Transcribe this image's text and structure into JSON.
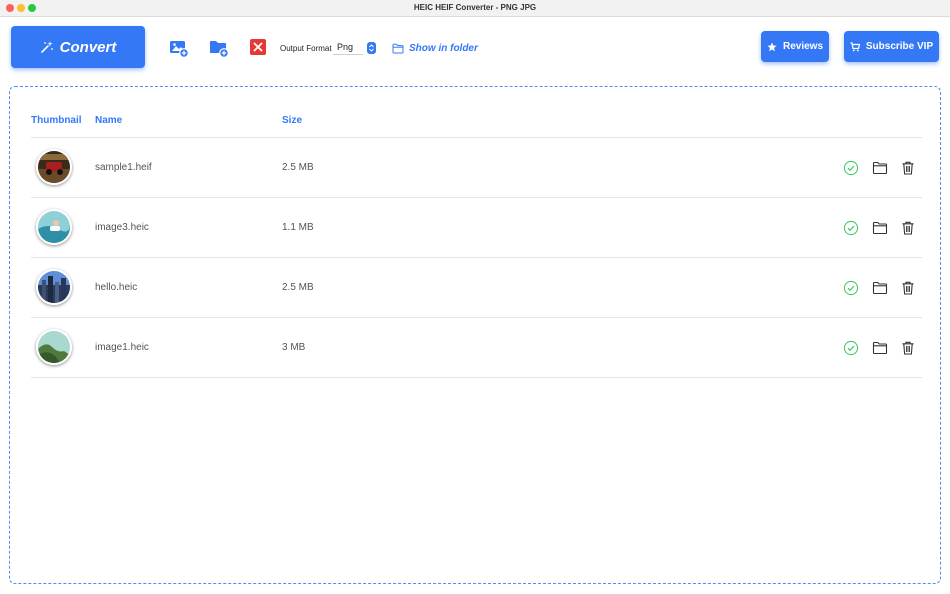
{
  "window": {
    "title": "HEIC HEIF Converter - PNG JPG"
  },
  "toolbar": {
    "convert_label": "Convert",
    "output_format_label": "Output Format",
    "output_format_value": "Png",
    "show_in_folder_label": "Show in folder",
    "reviews_label": "Reviews",
    "subscribe_label": "Subscribe VIP"
  },
  "table": {
    "headers": {
      "thumbnail": "Thumbnail",
      "name": "Name",
      "size": "Size"
    },
    "rows": [
      {
        "name": "sample1.heif",
        "size": "2.5 MB",
        "status": "done"
      },
      {
        "name": "image3.heic",
        "size": "1.1 MB",
        "status": "done"
      },
      {
        "name": "hello.heic",
        "size": "2.5 MB",
        "status": "done"
      },
      {
        "name": "image1.heic",
        "size": "3 MB",
        "status": "done"
      }
    ]
  },
  "colors": {
    "accent": "#3478f6",
    "success": "#34c759",
    "danger": "#e53935"
  }
}
